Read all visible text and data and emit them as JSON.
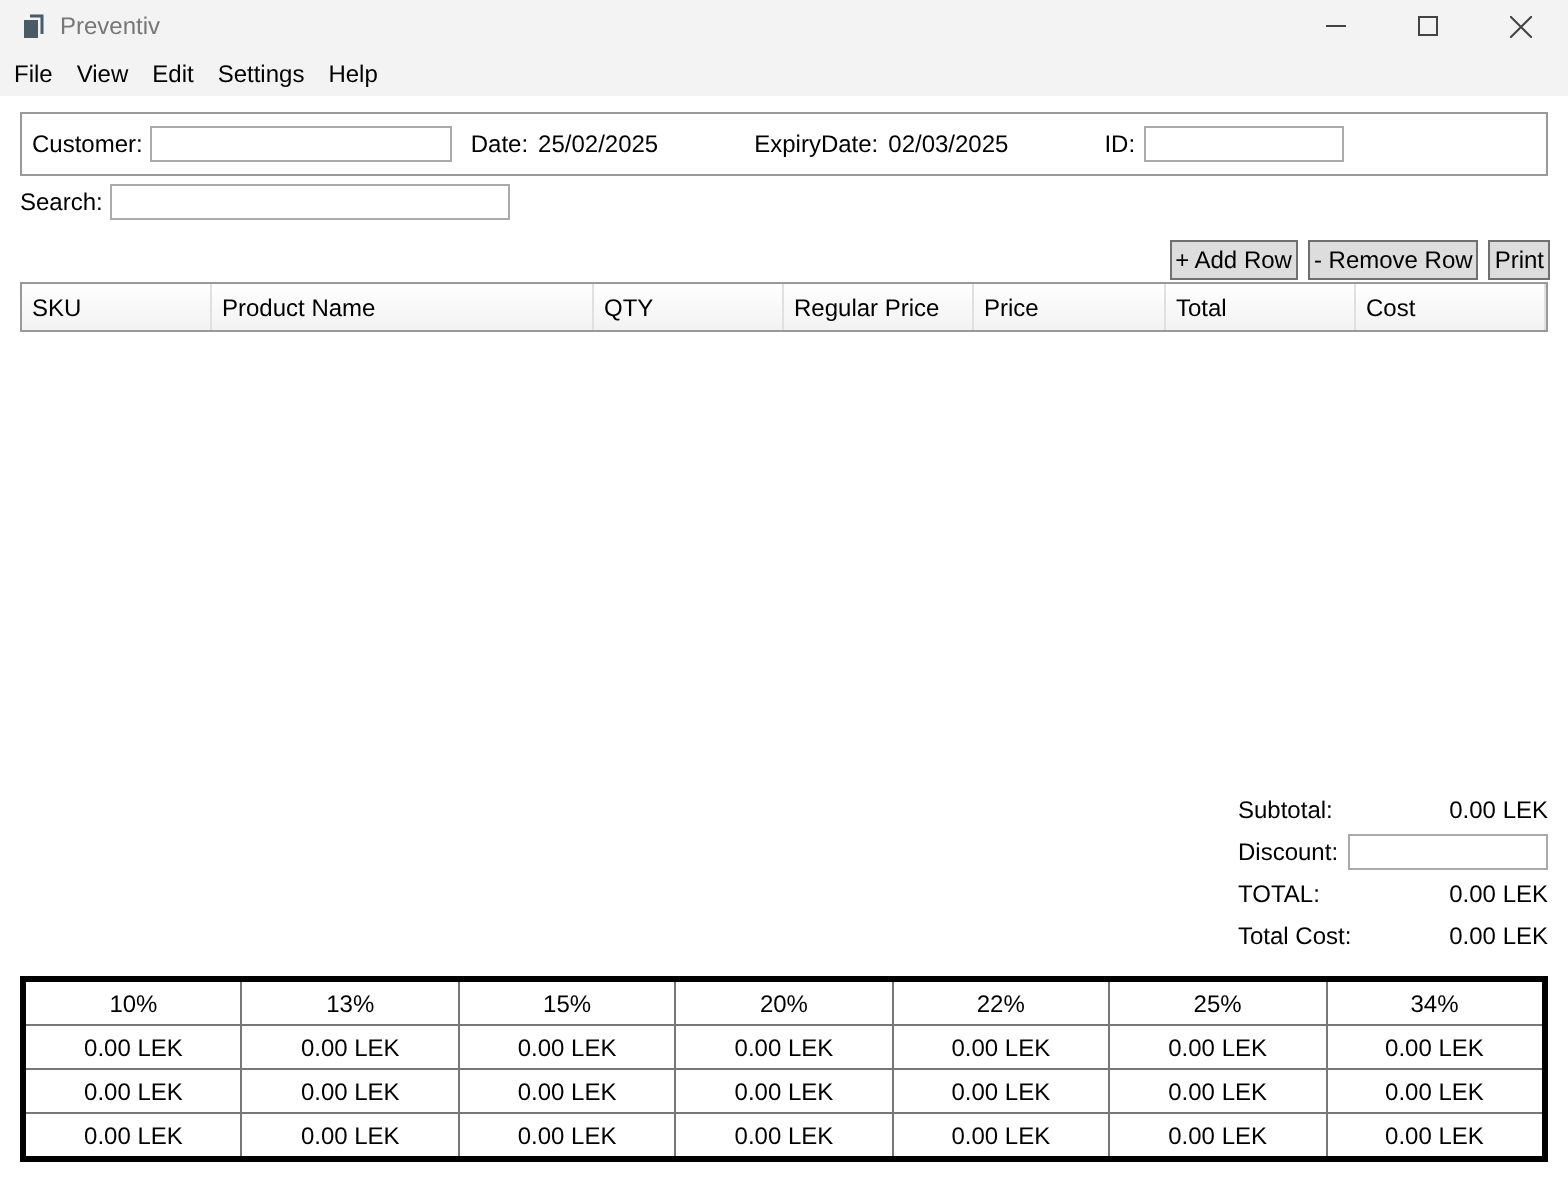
{
  "window": {
    "title": "Preventiv"
  },
  "menu": [
    "File",
    "View",
    "Edit",
    "Settings",
    "Help"
  ],
  "header": {
    "customer_label": "Customer:",
    "date_label": "Date:",
    "date": "25/02/2025",
    "expiry_label": "ExpiryDate:",
    "expiry": "02/03/2025",
    "id_label": "ID:"
  },
  "search": {
    "label": "Search:"
  },
  "buttons": [
    "+ Add Row",
    "- Remove Row",
    "Print"
  ],
  "table": {
    "columns": [
      "SKU",
      "Product Name",
      "QTY",
      "Regular Price",
      "Price",
      "Total",
      "Cost"
    ]
  },
  "summary": [
    {
      "kind": "value",
      "label": "Subtotal:",
      "value": "0.00 LEK"
    },
    {
      "kind": "field",
      "label": "Discount:"
    },
    {
      "kind": "value",
      "label": "TOTAL:",
      "value": "0.00 LEK"
    },
    {
      "kind": "value",
      "label": "Total Cost:",
      "value": "0.00 LEK"
    }
  ],
  "rates": {
    "columns": [
      "10%",
      "13%",
      "15%",
      "20%",
      "22%",
      "25%",
      "34%"
    ],
    "rows": [
      [
        "0.00 LEK",
        "0.00 LEK",
        "0.00 LEK",
        "0.00 LEK",
        "0.00 LEK",
        "0.00 LEK",
        "0.00 LEK"
      ],
      [
        "0.00 LEK",
        "0.00 LEK",
        "0.00 LEK",
        "0.00 LEK",
        "0.00 LEK",
        "0.00 LEK",
        "0.00 LEK"
      ],
      [
        "0.00 LEK",
        "0.00 LEK",
        "0.00 LEK",
        "0.00 LEK",
        "0.00 LEK",
        "0.00 LEK",
        "0.00 LEK"
      ]
    ]
  }
}
